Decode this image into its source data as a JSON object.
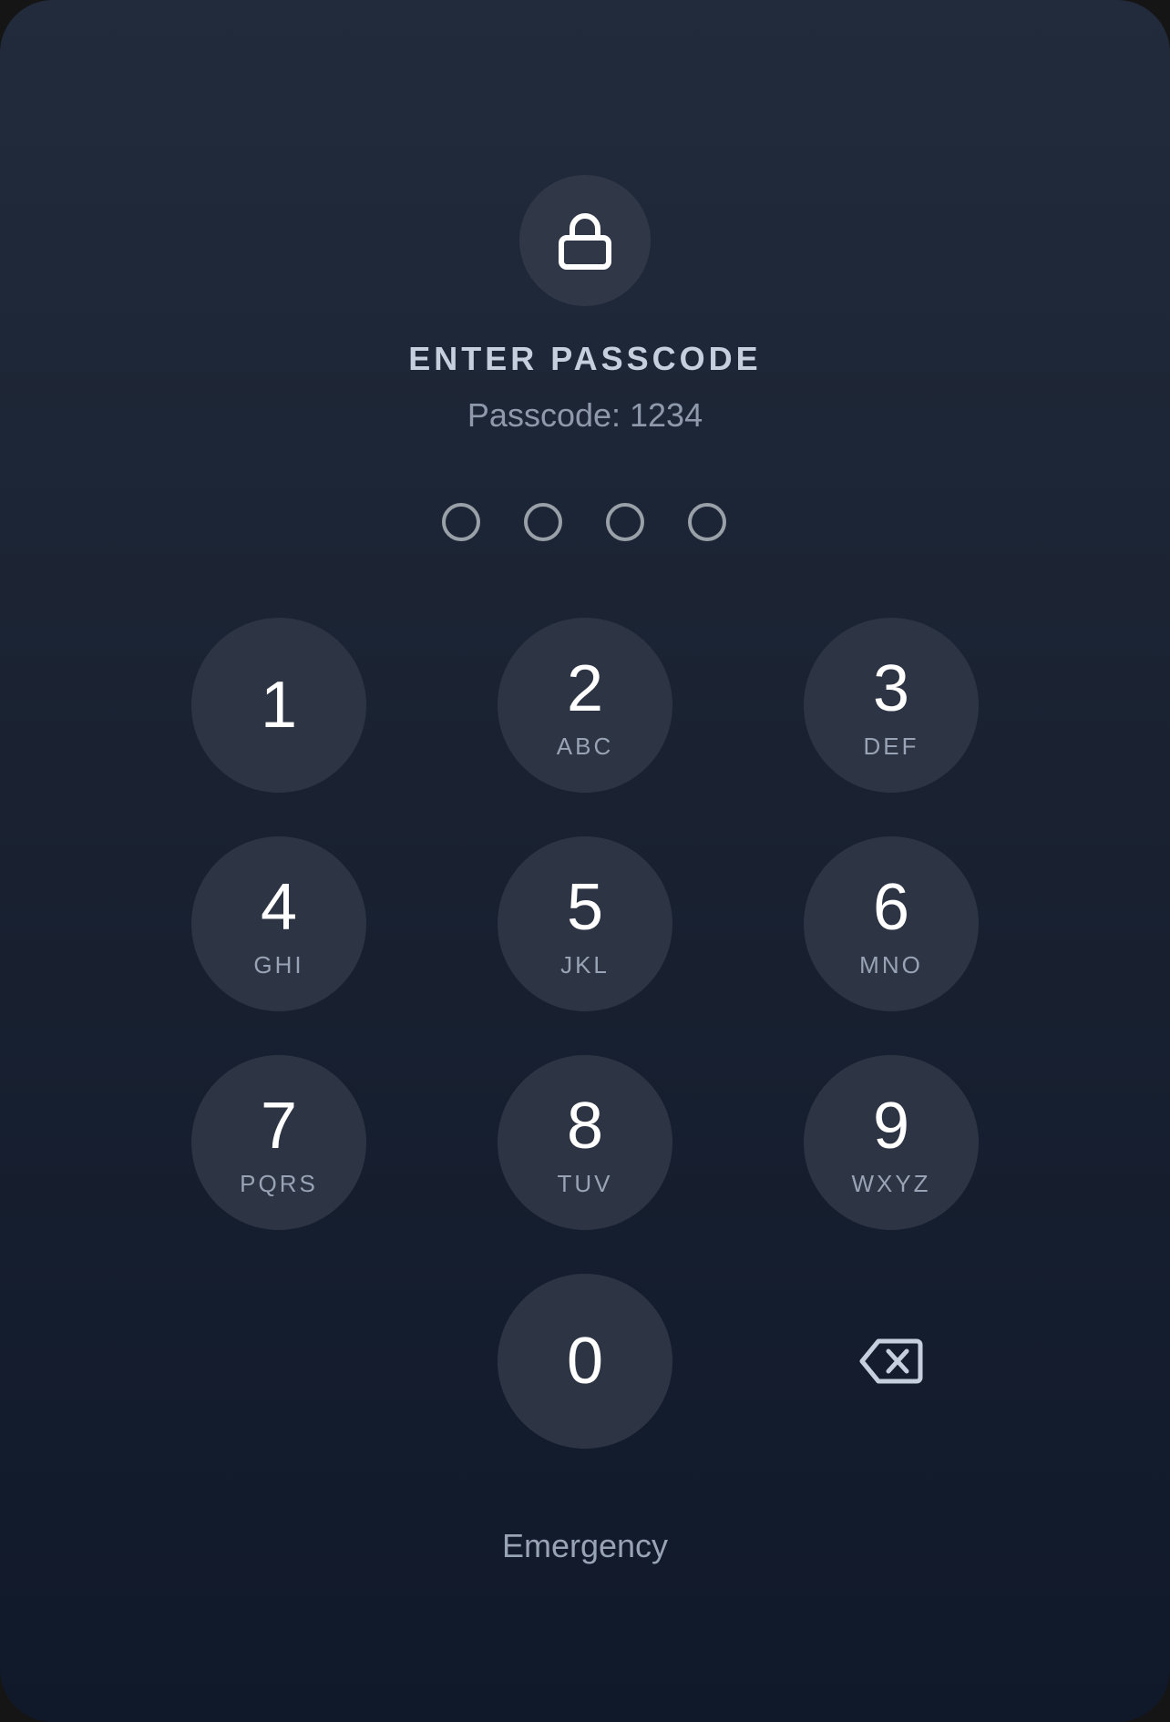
{
  "lock": {
    "icon": "lock-icon"
  },
  "header": {
    "title": "ENTER PASSCODE",
    "hint": "Passcode: 1234"
  },
  "passcode": {
    "length": 4,
    "entered": 0
  },
  "keypad": {
    "keys": [
      {
        "digit": "1",
        "letters": ""
      },
      {
        "digit": "2",
        "letters": "ABC"
      },
      {
        "digit": "3",
        "letters": "DEF"
      },
      {
        "digit": "4",
        "letters": "GHI"
      },
      {
        "digit": "5",
        "letters": "JKL"
      },
      {
        "digit": "6",
        "letters": "MNO"
      },
      {
        "digit": "7",
        "letters": "PQRS"
      },
      {
        "digit": "8",
        "letters": "TUV"
      },
      {
        "digit": "9",
        "letters": "WXYZ"
      },
      {
        "digit": "0",
        "letters": ""
      }
    ],
    "delete_icon": "backspace-icon"
  },
  "footer": {
    "emergency_label": "Emergency"
  },
  "colors": {
    "background_top": "#212b3b",
    "background_bottom": "#10192a",
    "key_fill": "#2d3443",
    "title_text": "#c6cfdd",
    "muted_text": "#98a3b5",
    "dot_outline": "#9aa0a8"
  }
}
